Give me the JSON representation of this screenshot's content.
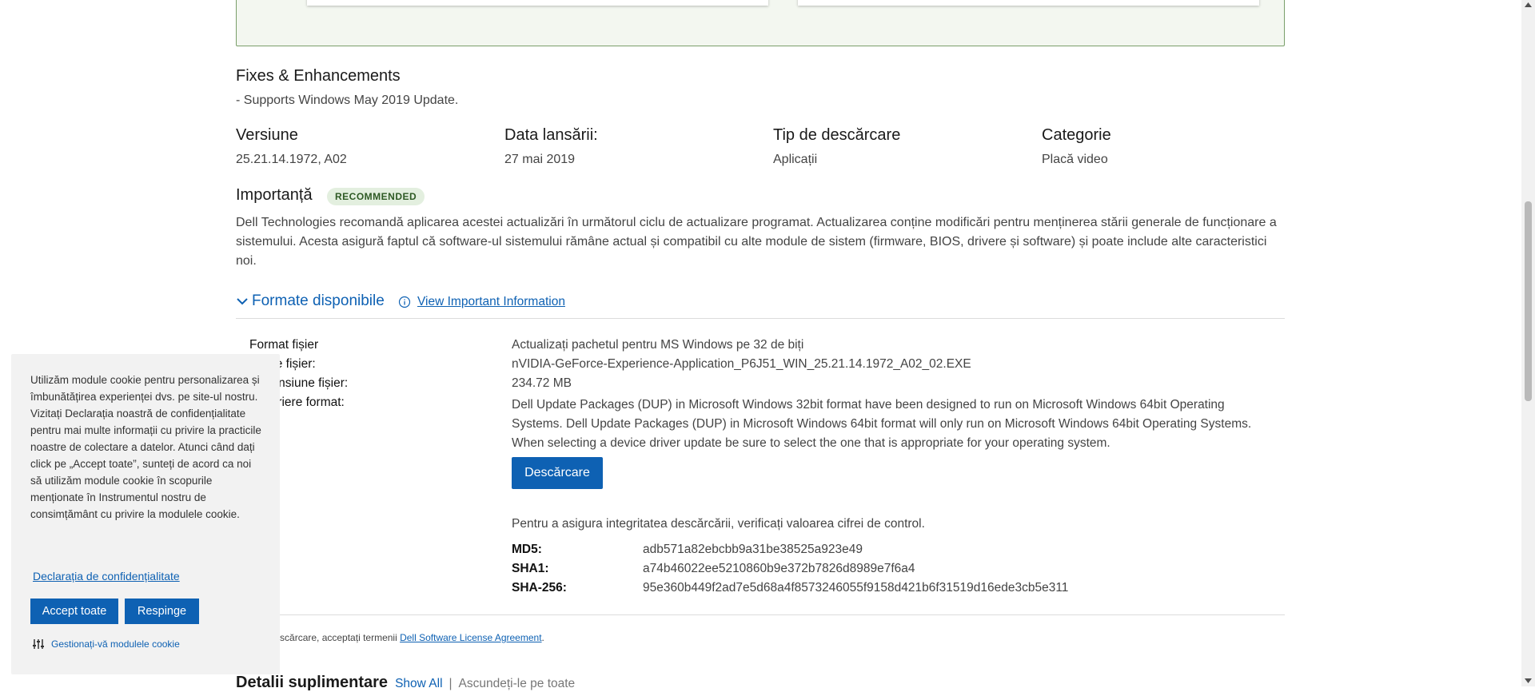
{
  "fixes": {
    "title": "Fixes & Enhancements",
    "text": "- Supports Windows May 2019 Update."
  },
  "meta": [
    {
      "label": "Versiune",
      "value": "25.21.14.1972, A02"
    },
    {
      "label": "Data lansării:",
      "value": "27 mai 2019"
    },
    {
      "label": "Tip de descărcare",
      "value": "Aplicații"
    },
    {
      "label": "Categorie",
      "value": "Placă video"
    }
  ],
  "importance": {
    "title": "Importanță",
    "badge": "RECOMMENDED",
    "text": "Dell Technologies recomandă aplicarea acestei actualizări în următorul ciclu de actualizare programat. Actualizarea conține modificări pentru menținerea stării generale de funcționare a sistemului. Acesta asigură faptul că software-ul sistemului rămâne actual și compatibil cu alte module de sistem (firmware, BIOS, drivere și software) și poate include alte caracteristici noi."
  },
  "formats": {
    "toggle_label": "Formate disponibile",
    "info_link": "View Important Information",
    "rows": [
      {
        "label": "Format fișier",
        "value": "Actualizați pachetul pentru MS Windows pe 32 de biți"
      },
      {
        "label": "Nume fișier:",
        "value": "nVIDIA-GeForce-Experience-Application_P6J51_WIN_25.21.14.1972_A02_02.EXE"
      },
      {
        "label": "Dimensiune fișier:",
        "value": "234.72 MB"
      },
      {
        "label": "Descriere format:",
        "value": "Dell Update Packages (DUP) in Microsoft Windows 32bit format have been designed to run on Microsoft Windows 64bit Operating Systems. Dell Update Packages (DUP) in Microsoft Windows 64bit format will only run on Microsoft Windows 64bit Operating Systems. When selecting a device driver update be sure to select the one that is appropriate for your operating system."
      }
    ],
    "download_button": "Descărcare",
    "checksum_intro": "Pentru a asigura integritatea descărcării, verificați valoarea cifrei de control.",
    "checksums": [
      {
        "label": "MD5:",
        "value": "adb571a82ebcbb9a31be38525a923e49"
      },
      {
        "label": "SHA1:",
        "value": "a74b46022ee5210860b9e372b7826d8989e7f6a4"
      },
      {
        "label": "SHA-256:",
        "value": "95e360b449f2ad7e5d68a4f8573246055f9158d421b6f31519d16ede3cb5e311"
      }
    ],
    "license_prefix": "Prin descărcare, acceptați termenii",
    "license_link": "Dell Software License Agreement",
    "license_suffix": "."
  },
  "details": {
    "title": "Detalii suplimentare",
    "show_all": "Show All",
    "separator": "|",
    "hide_all": "Ascundeți-le pe toate"
  },
  "cookie": {
    "text": "Utilizăm module cookie pentru personalizarea și îmbunătățirea experienței dvs. pe site-ul nostru. Vizitați Declarația noastră de confidențialitate pentru mai multe informații cu privire la practicile noastre de colectare a datelor. Atunci când dați click pe „Accept toate”, sunteți de acord ca noi să utilizăm module cookie în scopurile menționate în Instrumentul nostru de consimțământ cu privire la modulele cookie.",
    "privacy_link": "Declarația de confidențialitate",
    "accept": "Accept toate",
    "reject": "Respinge",
    "manage": "Gestionați-vă modulele cookie"
  },
  "colors": {
    "accent": "#0e61b3",
    "badge_bg": "#e3efdf",
    "badge_text": "#2e5a24",
    "panel_border": "#7a9f6a"
  }
}
